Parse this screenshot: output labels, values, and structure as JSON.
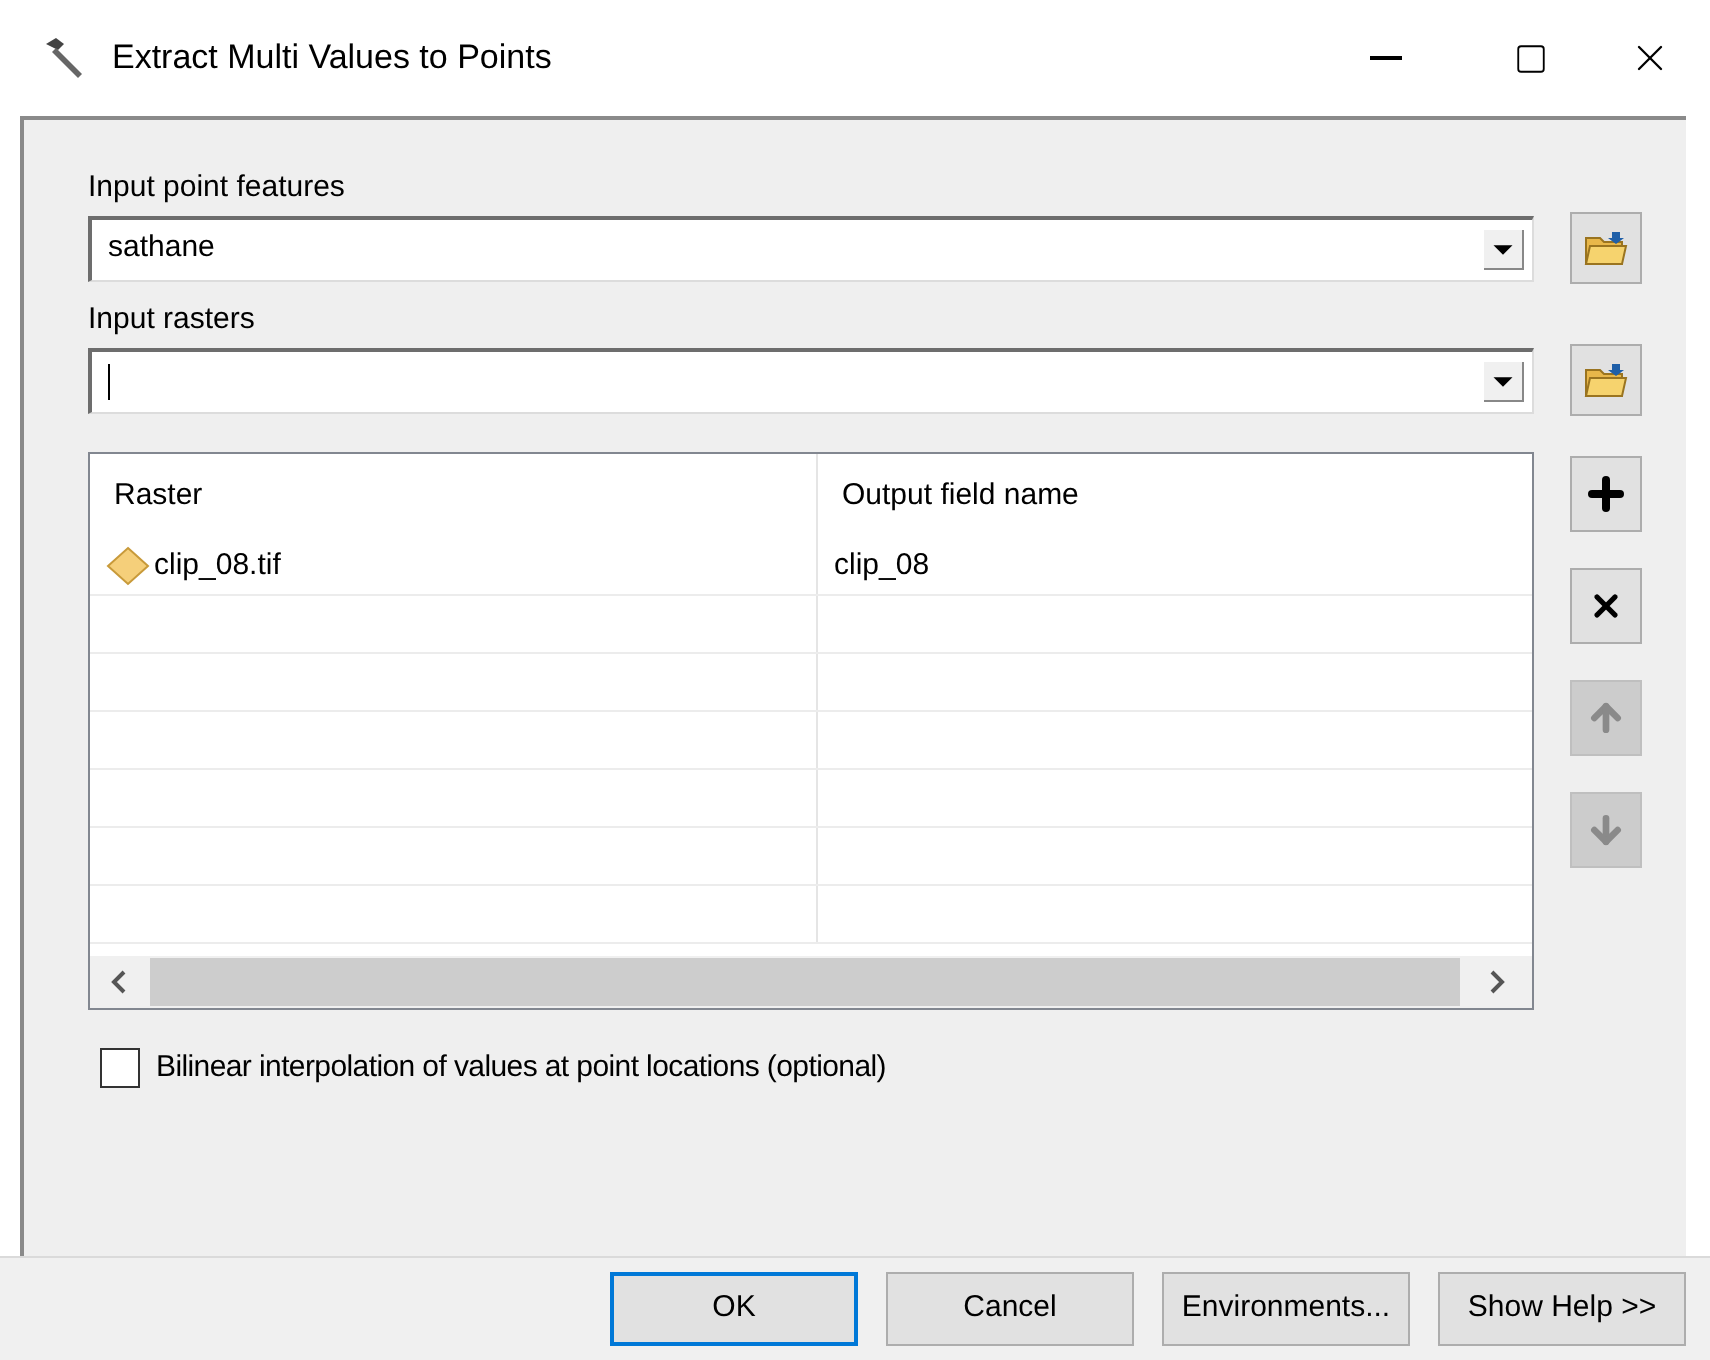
{
  "window": {
    "title": "Extract Multi Values to Points"
  },
  "fields": [
    {
      "label": "Input point features",
      "value": "sathane"
    },
    {
      "label": "Input rasters"
    }
  ],
  "table": {
    "columns": [
      "Raster",
      "Output field name"
    ],
    "rows": [
      {
        "raster": "clip_08.tif",
        "output_field_name": "clip_08"
      }
    ]
  },
  "table_buttons": [
    {
      "kind": "add",
      "disabled": false
    },
    {
      "kind": "remove",
      "disabled": false
    },
    {
      "kind": "up",
      "disabled": true
    },
    {
      "kind": "down",
      "disabled": true
    }
  ],
  "checkbox": {
    "label": "Bilinear interpolation of values at point locations (optional)",
    "checked": false
  },
  "buttons": [
    {
      "label": "OK",
      "default": true
    },
    {
      "label": "Cancel",
      "default": false
    },
    {
      "label": "Environments...",
      "default": false
    },
    {
      "label": "Show Help >>",
      "default": false
    }
  ]
}
